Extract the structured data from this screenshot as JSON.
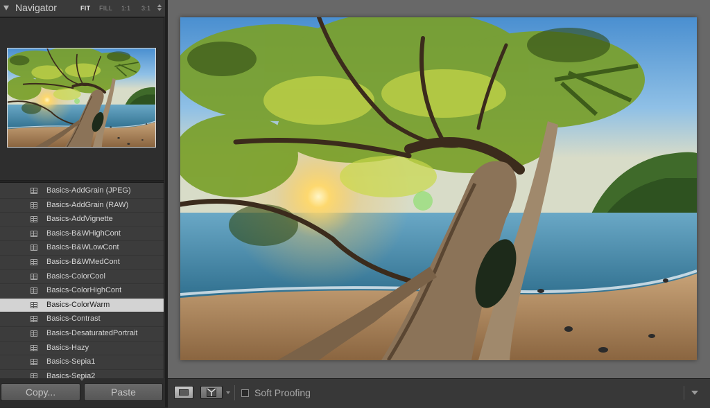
{
  "navigator": {
    "title": "Navigator",
    "zoom_options": [
      "FIT",
      "FILL",
      "1:1",
      "3:1"
    ],
    "active_zoom": "FIT"
  },
  "presets": {
    "items": [
      "Basics-AddGrain (JPEG)",
      "Basics-AddGrain (RAW)",
      "Basics-AddVignette",
      "Basics-B&WHighCont",
      "Basics-B&WLowCont",
      "Basics-B&WMedCont",
      "Basics-ColorCool",
      "Basics-ColorHighCont",
      "Basics-ColorWarm",
      "Basics-Contrast",
      "Basics-DesaturatedPortrait",
      "Basics-Hazy",
      "Basics-Sepia1",
      "Basics-Sepia2"
    ],
    "selected": "Basics-ColorWarm"
  },
  "buttons": {
    "copy": "Copy...",
    "paste": "Paste"
  },
  "toolbar": {
    "soft_proofing_label": "Soft Proofing",
    "soft_proofing_checked": false
  },
  "icons": {
    "loupe": "loupe-view-icon",
    "compare": "compare-view-icon",
    "preset": "preset-icon",
    "collapse": "disclosure-triangle-icon"
  },
  "colors": {
    "panel_bg": "#3c3c3c",
    "main_bg": "#686868",
    "selected_row": "#d3d3d3"
  }
}
